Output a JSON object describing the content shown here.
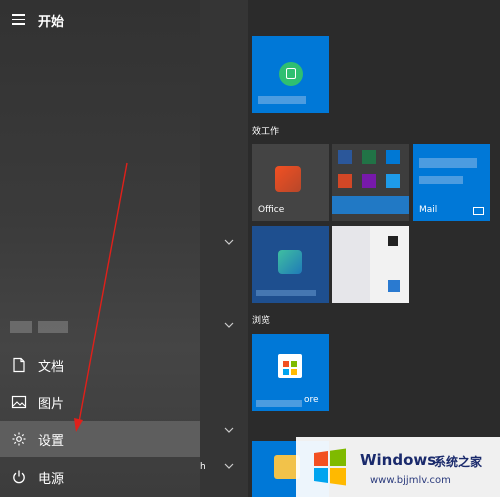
{
  "header": {
    "title": "开始"
  },
  "nav": {
    "documents": "文档",
    "pictures": "图片",
    "settings": "设置",
    "power": "电源"
  },
  "tiles": {
    "work_group": "效工作",
    "office": "Office",
    "mail": "Mail",
    "browse_group": "浏览",
    "store": "ore",
    "partial": "h"
  },
  "watermark": {
    "brand": "Windows",
    "cn": "系统之家",
    "url": "www.bjjmlv.com"
  },
  "colors": {
    "accent": "#0078d7",
    "arrow": "#e0201a"
  }
}
